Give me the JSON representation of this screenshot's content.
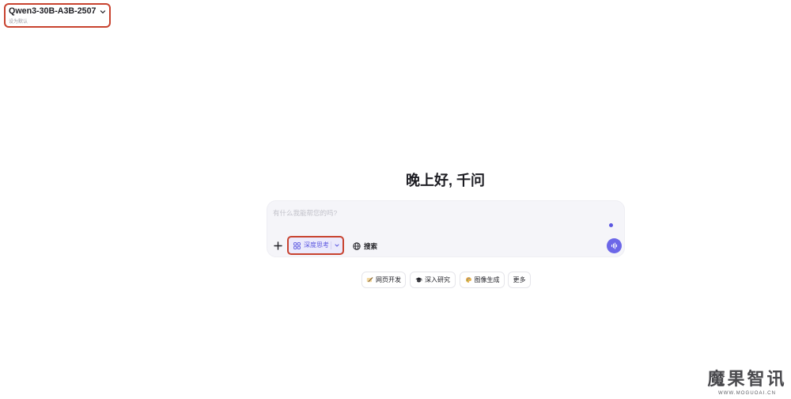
{
  "model_selector": {
    "name": "Qwen3-30B-A3B-2507",
    "subtitle": "设为默认",
    "icon": "chevron-down-icon"
  },
  "greeting": "晚上好, 千问",
  "composer": {
    "placeholder": "有什么我能帮您的吗?",
    "add_icon": "plus-icon",
    "status_icon": "dot-icon",
    "deep_think": {
      "label": "深度思考",
      "icon": "deep-think-icon",
      "dropdown_icon": "chevron-down-icon"
    },
    "search": {
      "label": "搜索",
      "icon": "globe-icon"
    },
    "voice_icon": "voice-wave-icon"
  },
  "suggestions": [
    {
      "label": "网页开发",
      "icon": "web-dev-icon"
    },
    {
      "label": "深入研究",
      "icon": "graduation-cap-icon"
    },
    {
      "label": "图像生成",
      "icon": "palette-icon"
    },
    {
      "label": "更多"
    }
  ],
  "watermark": {
    "text": "魔果智讯",
    "site": "WWW.MOGUOAI.CN"
  },
  "colors": {
    "accent": "#5b57e0",
    "accent_soft": "#ebeafc",
    "highlight": "#c8432f",
    "composer_bg": "#f5f5f9"
  }
}
